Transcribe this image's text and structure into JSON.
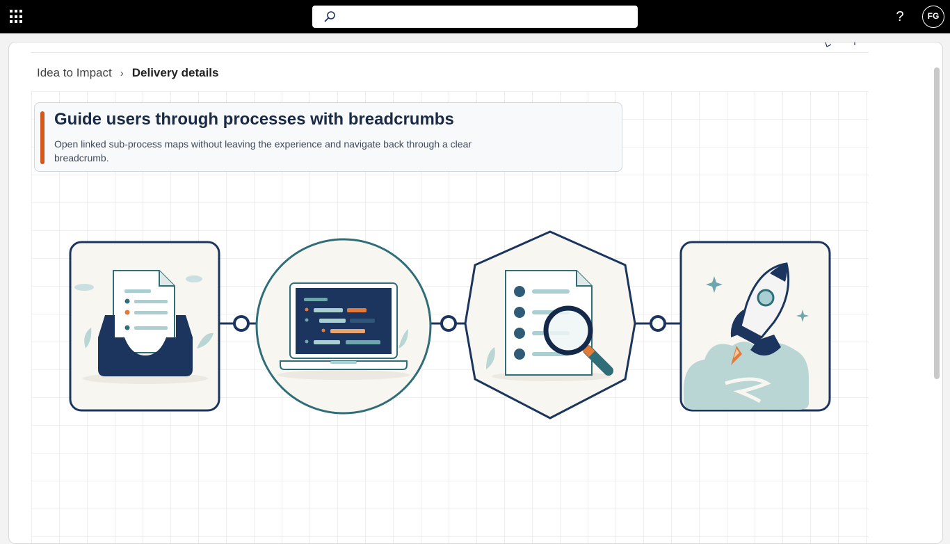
{
  "topbar": {
    "search": {
      "placeholder": "",
      "value": ""
    },
    "help_label": "?",
    "avatar_initials": "FG"
  },
  "breadcrumb": {
    "parent": "Idea to Impact",
    "separator": "›",
    "current": "Delivery details"
  },
  "callout": {
    "title": "Guide users through processes with breadcrumbs",
    "body": "Open linked sub-process maps without leaving the experience and navigate back through a clear breadcrumb."
  },
  "diagram": {
    "steps": [
      {
        "icon": "inbox-document-icon",
        "shape": "rounded-square"
      },
      {
        "icon": "laptop-code-icon",
        "shape": "circle"
      },
      {
        "icon": "document-magnifier-icon",
        "shape": "hexagon"
      },
      {
        "icon": "rocket-launch-icon",
        "shape": "rounded-square"
      }
    ],
    "colors": {
      "navy": "#1c355e",
      "teal": "#2f6e78",
      "orange": "#e07b3a",
      "light_teal": "#a9cfd3",
      "cream": "#f8f6f1"
    }
  },
  "colors": {
    "accent": "#d4571b",
    "topbar": "#000000"
  }
}
